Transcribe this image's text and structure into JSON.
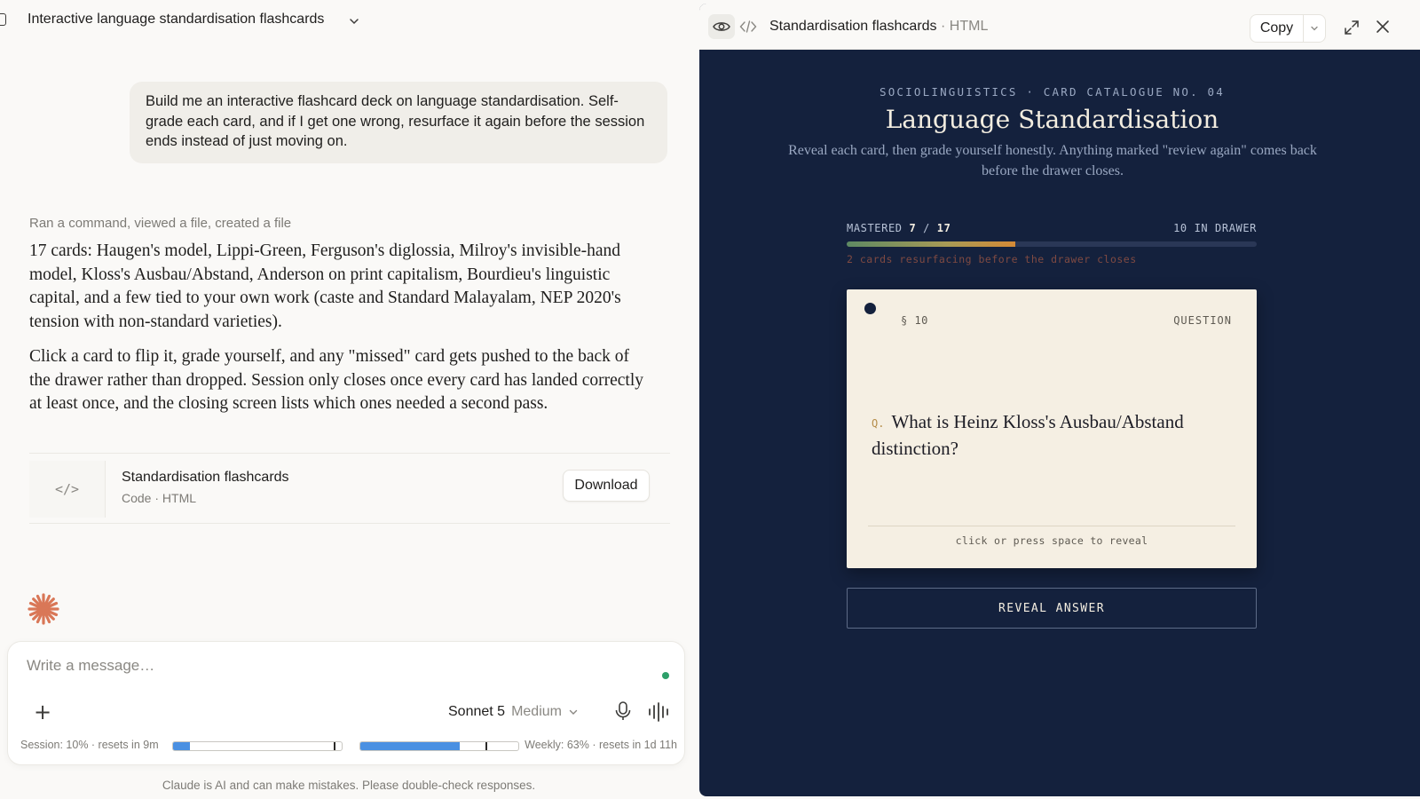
{
  "conversation": {
    "title": "Interactive language standardisation flashcards"
  },
  "user_message": {
    "text": "Build me an interactive flashcard deck on language standardisation. Self-grade each card, and if I get one wrong, resurface it again before the session ends instead of just moving on."
  },
  "assistant": {
    "activity_summary": "Ran a command, viewed a file, created a file",
    "paragraphs": [
      "17 cards: Haugen's model, Lippi-Green, Ferguson's diglossia, Milroy's invisible-hand model, Kloss's Ausbau/Abstand, Anderson on print capitalism, Bourdieu's linguistic capital, and a few tied to your own work (caste and Standard Malayalam, NEP 2020's tension with non-standard varieties).",
      "Click a card to flip it, grade yourself, and any \"missed\" card gets pushed to the back of the drawer rather than dropped. Session only closes once every card has landed correctly at least once, and the closing screen lists which ones needed a second pass."
    ],
    "artifact": {
      "name": "Standardisation flashcards",
      "meta": "Code · HTML",
      "download_label": "Download",
      "icon": "code-icon"
    }
  },
  "composer": {
    "placeholder": "Write a message…",
    "model_name": "Sonnet 5",
    "model_effort": "Medium",
    "session_usage_label": "Session: 10% · resets in 9m",
    "weekly_usage_label": "Weekly: 63% · resets in 1d 11h",
    "session_usage_fraction": 0.1,
    "weekly_usage_fraction": 0.63,
    "status_color": "#2da06a",
    "icons": [
      "plus-icon",
      "chevron-down-icon",
      "microphone-icon",
      "voice-waveform-icon"
    ]
  },
  "disclaimer": "Claude is AI and can make mistakes. Please double-check responses.",
  "artifact_panel": {
    "title": "Standardisation flashcards",
    "subtitle": "· HTML",
    "copy_label": "Copy",
    "icons": [
      "eye-icon",
      "code-icon",
      "chevron-down-icon",
      "expand-icon",
      "close-icon"
    ]
  },
  "flashcard_app": {
    "eyebrow": "SOCIOLINGUISTICS · CARD CATALOGUE NO. 04",
    "title": "Language Standardisation",
    "subtitle": "Reveal each card, then grade yourself honestly. Anything marked \"review again\" comes back before the drawer closes.",
    "progress": {
      "mastered_label": "MASTERED",
      "mastered": "7",
      "separator": "/",
      "total": "17",
      "drawer_label": "10 IN DRAWER",
      "mastered_fraction": 0.412,
      "resurfacing_note": "2 cards resurfacing before the drawer closes"
    },
    "card": {
      "section": "§ 10",
      "side_label": "QUESTION",
      "q_marker": "Q.",
      "question": "What is Heinz Kloss's Ausbau/Abstand distinction?",
      "hint": "click or press space to reveal"
    },
    "reveal_label": "REVEAL ANSWER",
    "colors": {
      "background": "#14213d",
      "card": "#f5efe3",
      "accent_gold": "#b58d4a",
      "warning_red": "#7f4a42"
    }
  }
}
